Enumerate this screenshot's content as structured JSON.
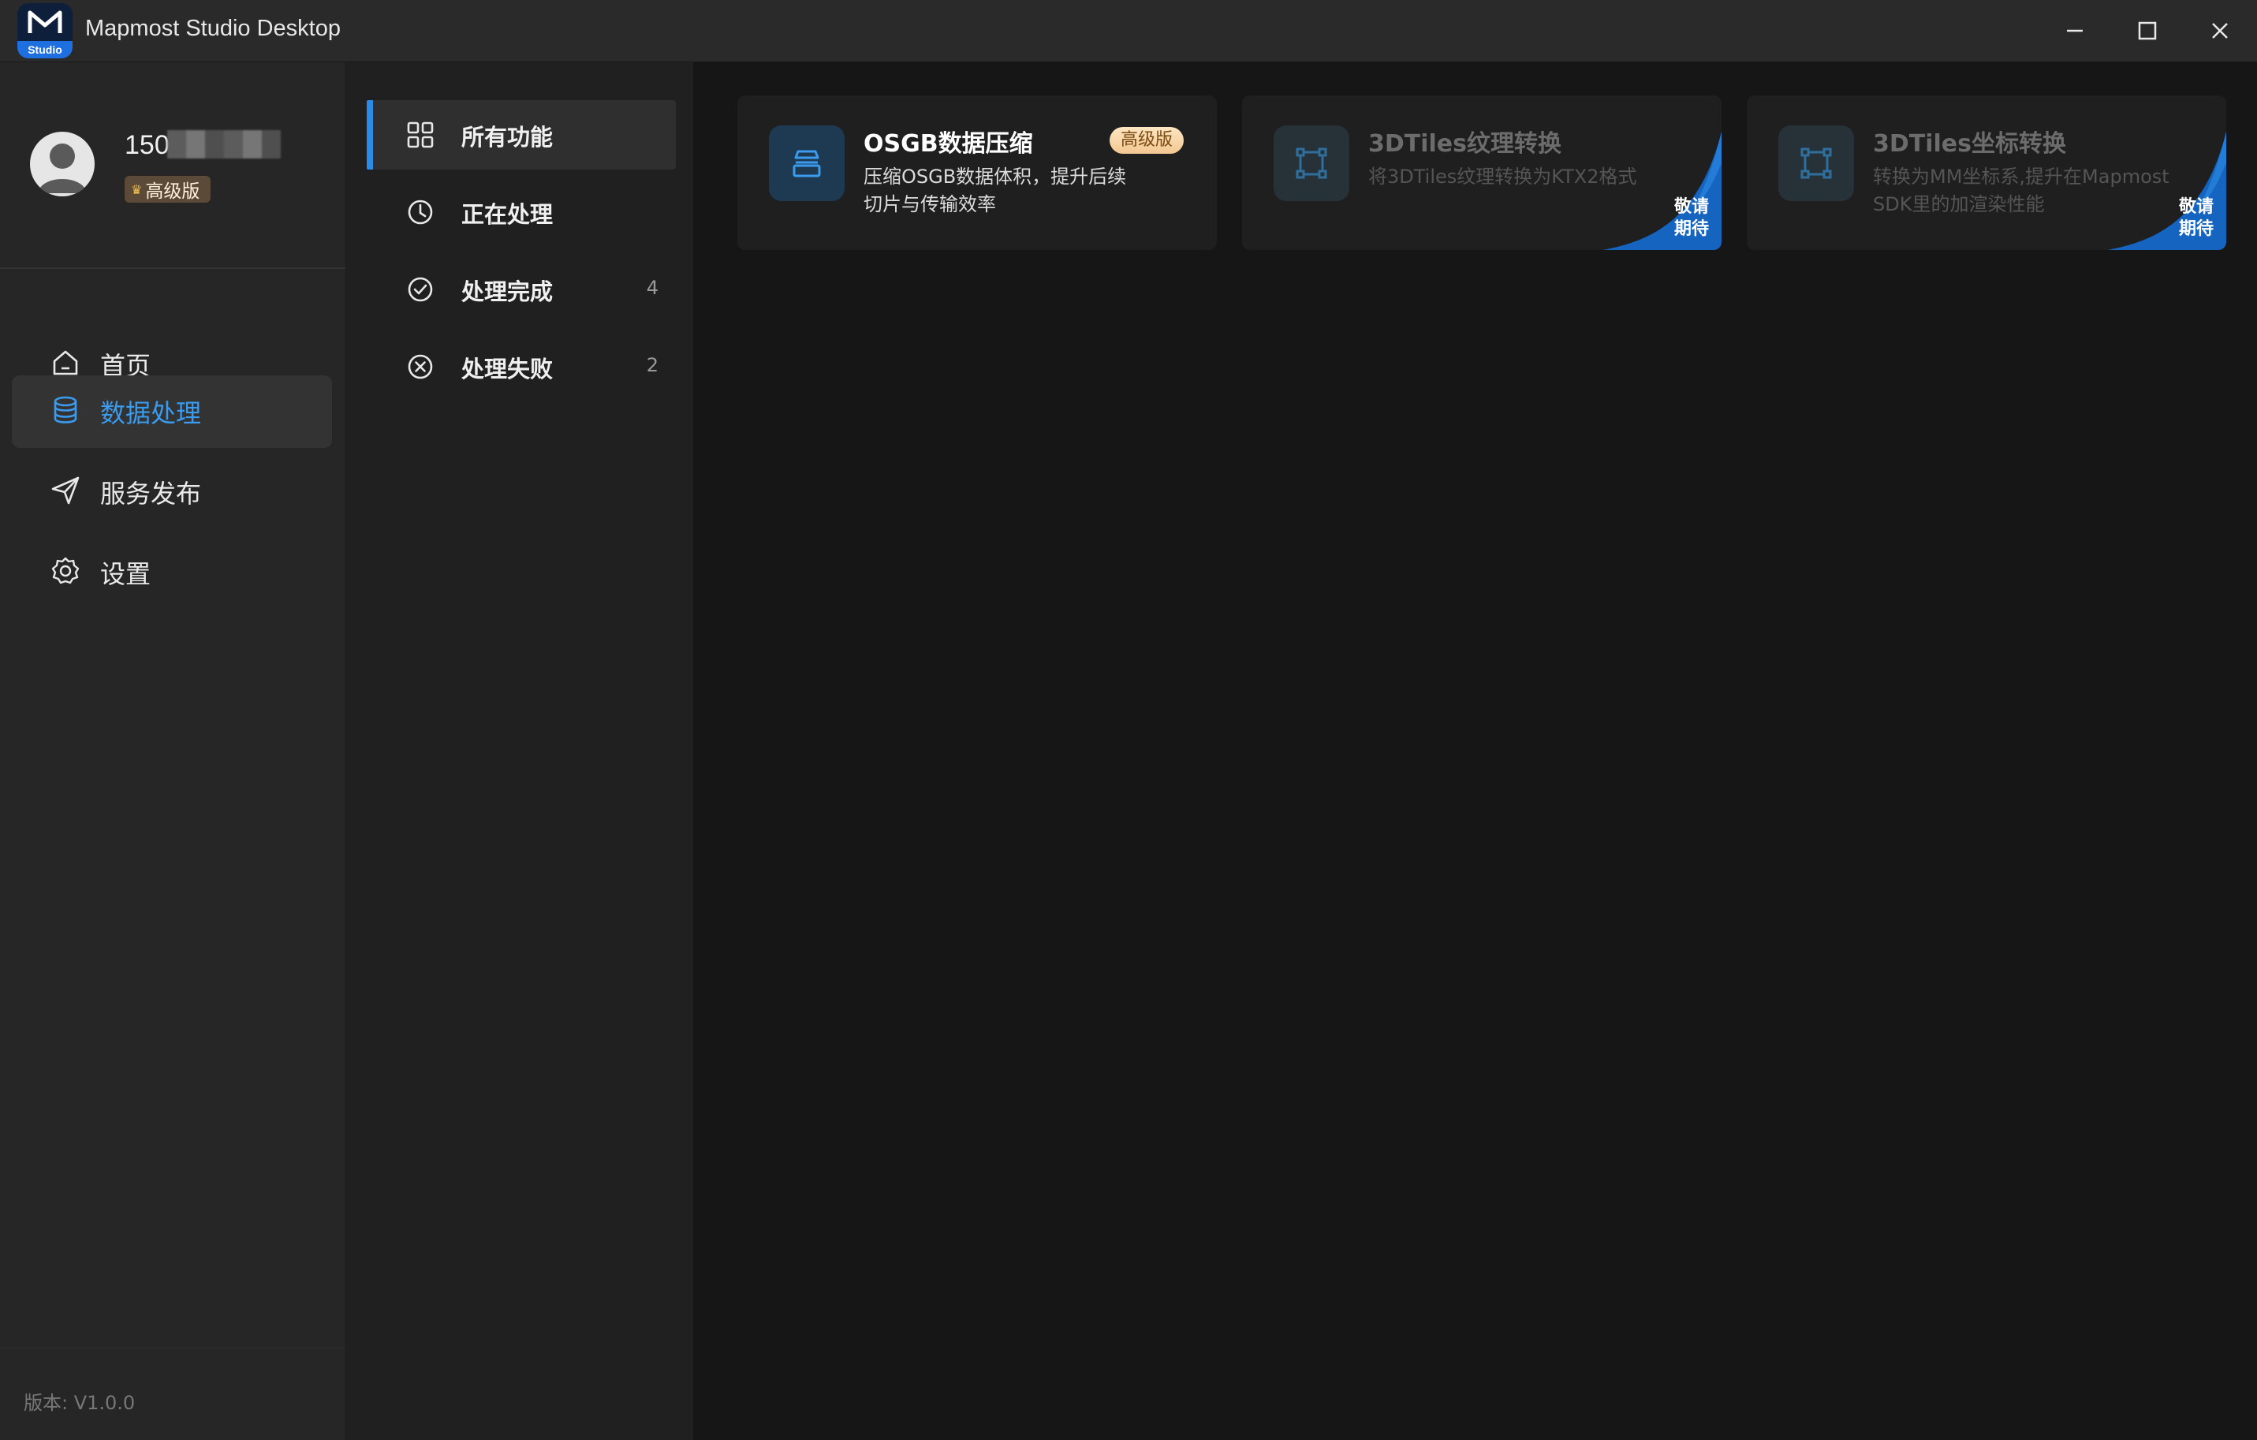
{
  "window": {
    "title": "Mapmost Studio Desktop",
    "logo_badge": "Studio"
  },
  "user": {
    "phone_prefix": "150",
    "tier": "高级版"
  },
  "sidebar": {
    "items": [
      {
        "label": "首页",
        "icon": "home-icon"
      },
      {
        "label": "数据处理",
        "icon": "database-icon",
        "active": true
      },
      {
        "label": "服务发布",
        "icon": "send-icon"
      },
      {
        "label": "设置",
        "icon": "gear-icon"
      }
    ],
    "version": "版本: V1.0.0"
  },
  "subnav": {
    "items": [
      {
        "label": "所有功能",
        "count": "",
        "icon": "grid-icon",
        "active": true
      },
      {
        "label": "正在处理",
        "count": "",
        "icon": "clock-icon"
      },
      {
        "label": "处理完成",
        "count": "4",
        "icon": "check-circle-icon"
      },
      {
        "label": "处理失败",
        "count": "2",
        "icon": "x-circle-icon"
      }
    ]
  },
  "cards": [
    {
      "title": "OSGB数据压缩",
      "desc": "压缩OSGB数据体积，提升后续切片与传输效率",
      "badge": "高级版"
    },
    {
      "title": "3DTiles纹理转换",
      "desc": "将3DTiles纹理转换为KTX2格式",
      "ribbon": "敬请期待"
    },
    {
      "title": "3DTiles坐标转换",
      "desc": "转换为MM坐标系,提升在Mapmost SDK里的加渲染性能",
      "ribbon": "敬请期待"
    }
  ],
  "colors": {
    "accent": "#2b8be6",
    "active_text": "#3a9bef",
    "ribbon": "#1565c0"
  }
}
